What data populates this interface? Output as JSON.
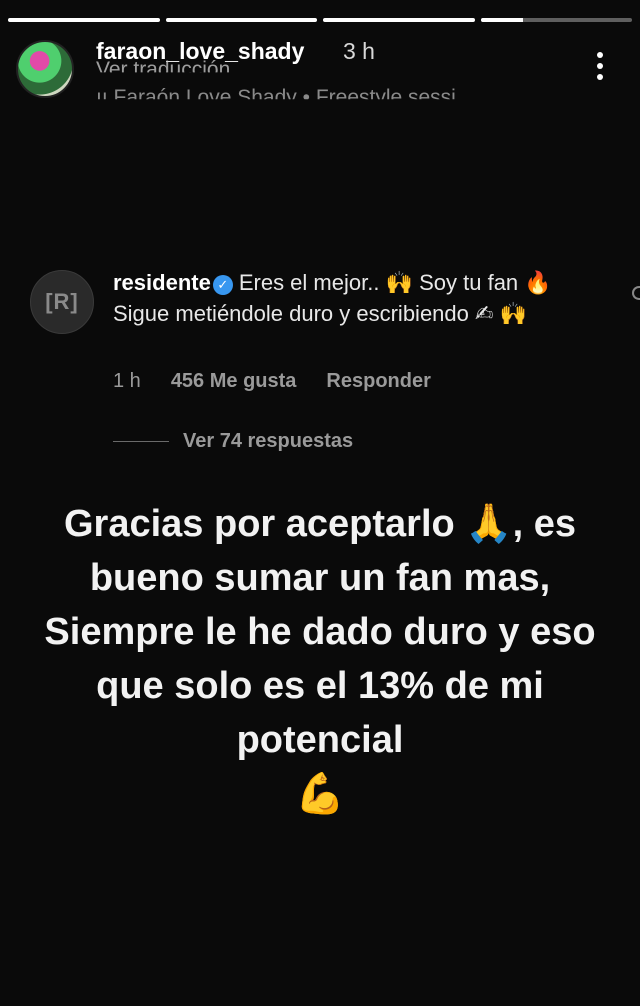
{
  "progress": [
    1,
    1,
    1,
    0.28
  ],
  "header": {
    "username": "faraon_love_shady",
    "time": "3 h",
    "faded_line_1": "Ver traducción",
    "faded_line_2": "ıı Faraón Love Shady • Freestyle sessi"
  },
  "comment": {
    "avatar_text": "[R]",
    "username": "residente",
    "text_part1": "Eres el mejor..",
    "emoji_hands": "🙌",
    "text_part2": "Soy tu fan",
    "emoji_fire": "🔥",
    "text_part3": "Sigue metiéndole duro  y escribiendo",
    "emoji_write": "✍",
    "time": "1 h",
    "likes": "456 Me gusta",
    "reply": "Responder",
    "view_replies": "Ver 74 respuestas"
  },
  "caption": {
    "line1a": "Gracias por aceptarlo",
    "emoji_pray": "🙏",
    "line1b": ", es",
    "line2": "bueno sumar un fan mas,",
    "line3": "Siempre le he dado duro y eso",
    "line4": "que solo es el 13% de mi",
    "line5": "potencial",
    "emoji_muscle": "💪"
  }
}
